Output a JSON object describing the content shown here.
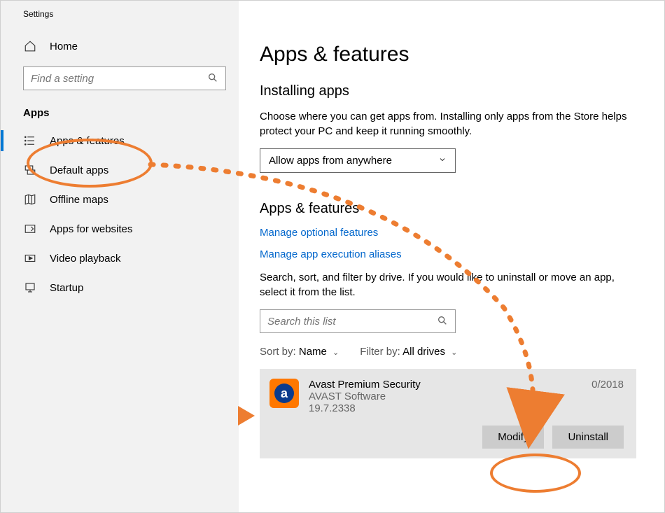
{
  "window": {
    "title": "Settings"
  },
  "sidebar": {
    "home_label": "Home",
    "search_placeholder": "Find a setting",
    "section_label": "Apps",
    "items": [
      {
        "label": "Apps & features"
      },
      {
        "label": "Default apps"
      },
      {
        "label": "Offline maps"
      },
      {
        "label": "Apps for websites"
      },
      {
        "label": "Video playback"
      },
      {
        "label": "Startup"
      }
    ]
  },
  "main": {
    "title": "Apps & features",
    "installing_heading": "Installing apps",
    "installing_desc": "Choose where you can get apps from. Installing only apps from the Store helps protect your PC and keep it running smoothly.",
    "install_dropdown": "Allow apps from anywhere",
    "apps_heading": "Apps & features",
    "link_optional": "Manage optional features",
    "link_aliases": "Manage app execution aliases",
    "filter_desc": "Search, sort, and filter by drive. If you would like to uninstall or move an app, select it from the list.",
    "search_placeholder": "Search this list",
    "sort_label": "Sort by:",
    "sort_value": "Name",
    "filter_label": "Filter by:",
    "filter_value": "All drives",
    "app": {
      "name": "Avast Premium Security",
      "publisher": "AVAST Software",
      "version": "19.7.2338",
      "date": "0/2018",
      "icon_letter": "a",
      "modify_label": "Modify",
      "uninstall_label": "Uninstall"
    }
  }
}
